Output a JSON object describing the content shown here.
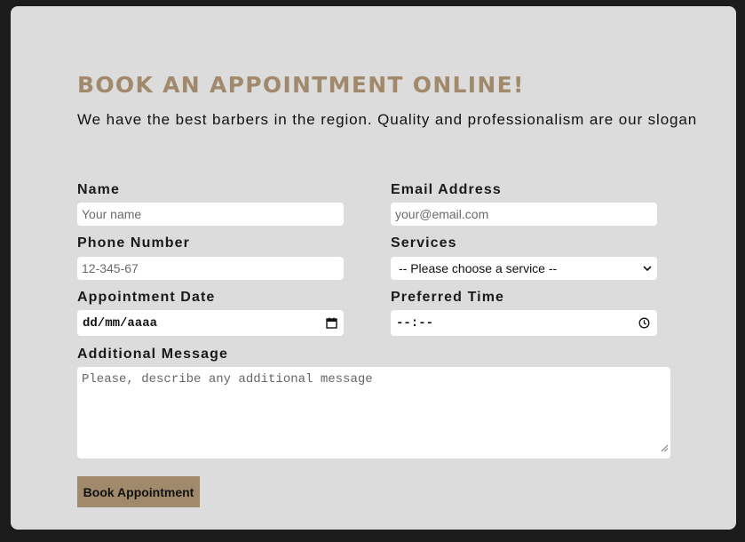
{
  "header": {
    "title": "BOOK AN APPOINTMENT ONLINE!",
    "subtitle": "We have the best barbers in the region. Quality and professionalism are our slogan"
  },
  "form": {
    "name": {
      "label": "Name",
      "placeholder": "Your name"
    },
    "email": {
      "label": "Email Address",
      "placeholder": "your@email.com"
    },
    "phone": {
      "label": "Phone Number",
      "placeholder": "12-345-67"
    },
    "services": {
      "label": "Services",
      "selected": "-- Please choose a service --"
    },
    "date": {
      "label": "Appointment Date",
      "placeholder": "dd/mm/aaaa",
      "icon": "calendar-icon"
    },
    "time": {
      "label": "Preferred Time",
      "placeholder": "--:--",
      "icon": "clock-icon"
    },
    "message": {
      "label": "Additional Message",
      "placeholder": "Please, describe any additional message"
    },
    "submit_label": "Book Appointment"
  },
  "colors": {
    "accent": "#a08a6b",
    "card_background": "#dcdcdc",
    "page_background": "#1c1c1c"
  }
}
